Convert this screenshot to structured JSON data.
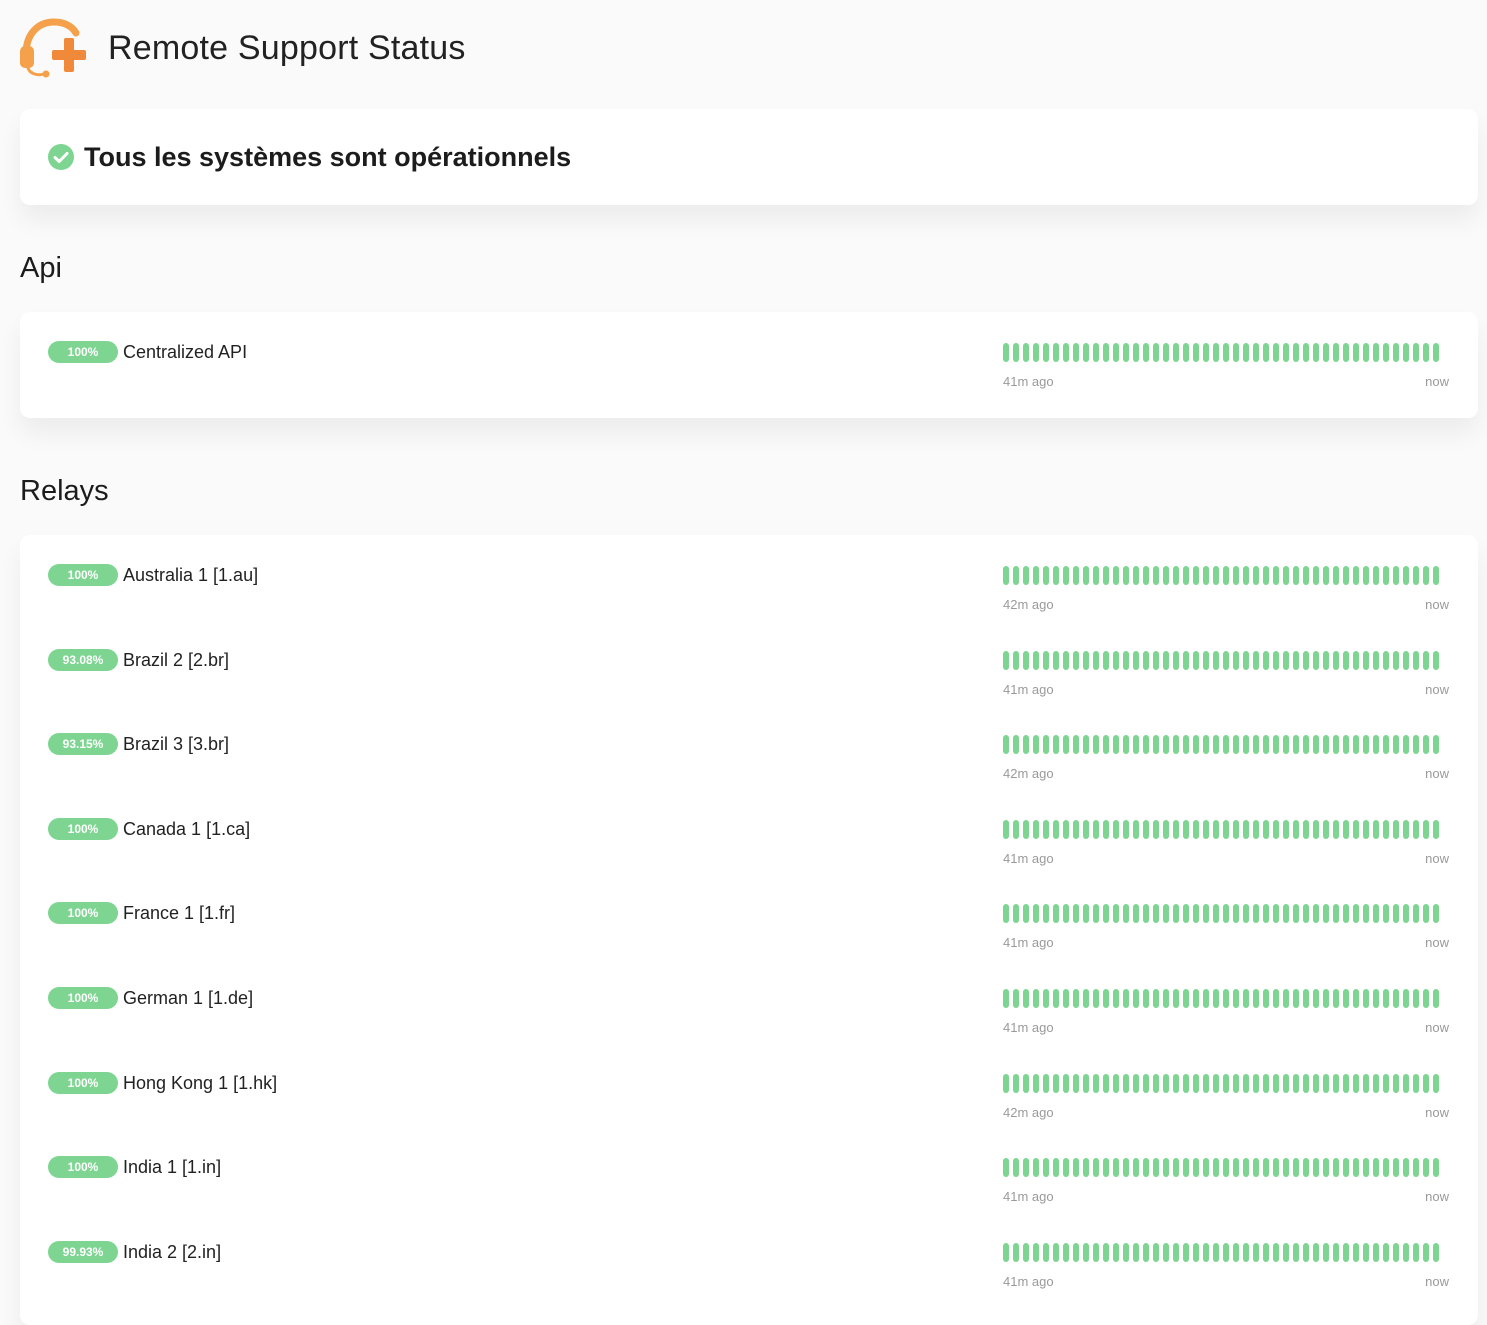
{
  "header": {
    "title": "Remote Support Status",
    "logo_icon": "headset-plus-icon",
    "logo_color": "#f5a04a"
  },
  "overall": {
    "icon": "check-circle-icon",
    "icon_color": "#7ed591",
    "text": "Tous les systèmes sont opérationnels"
  },
  "colors": {
    "up": "#7ed591"
  },
  "groups": [
    {
      "name": "Api",
      "monitors": [
        {
          "uptime": "100%",
          "name": "Centralized API",
          "since": "41m ago",
          "now": "now"
        }
      ]
    },
    {
      "name": "Relays",
      "monitors": [
        {
          "uptime": "100%",
          "name": "Australia 1 [1.au]",
          "since": "42m ago",
          "now": "now"
        },
        {
          "uptime": "93.08%",
          "name": "Brazil 2 [2.br]",
          "since": "41m ago",
          "now": "now"
        },
        {
          "uptime": "93.15%",
          "name": "Brazil 3 [3.br]",
          "since": "42m ago",
          "now": "now"
        },
        {
          "uptime": "100%",
          "name": "Canada 1 [1.ca]",
          "since": "41m ago",
          "now": "now"
        },
        {
          "uptime": "100%",
          "name": "France 1 [1.fr]",
          "since": "41m ago",
          "now": "now"
        },
        {
          "uptime": "100%",
          "name": "German 1 [1.de]",
          "since": "41m ago",
          "now": "now"
        },
        {
          "uptime": "100%",
          "name": "Hong Kong 1 [1.hk]",
          "since": "42m ago",
          "now": "now"
        },
        {
          "uptime": "100%",
          "name": "India 1 [1.in]",
          "since": "41m ago",
          "now": "now"
        },
        {
          "uptime": "99.93%",
          "name": "India 2 [2.in]",
          "since": "41m ago",
          "now": "now"
        }
      ]
    }
  ]
}
